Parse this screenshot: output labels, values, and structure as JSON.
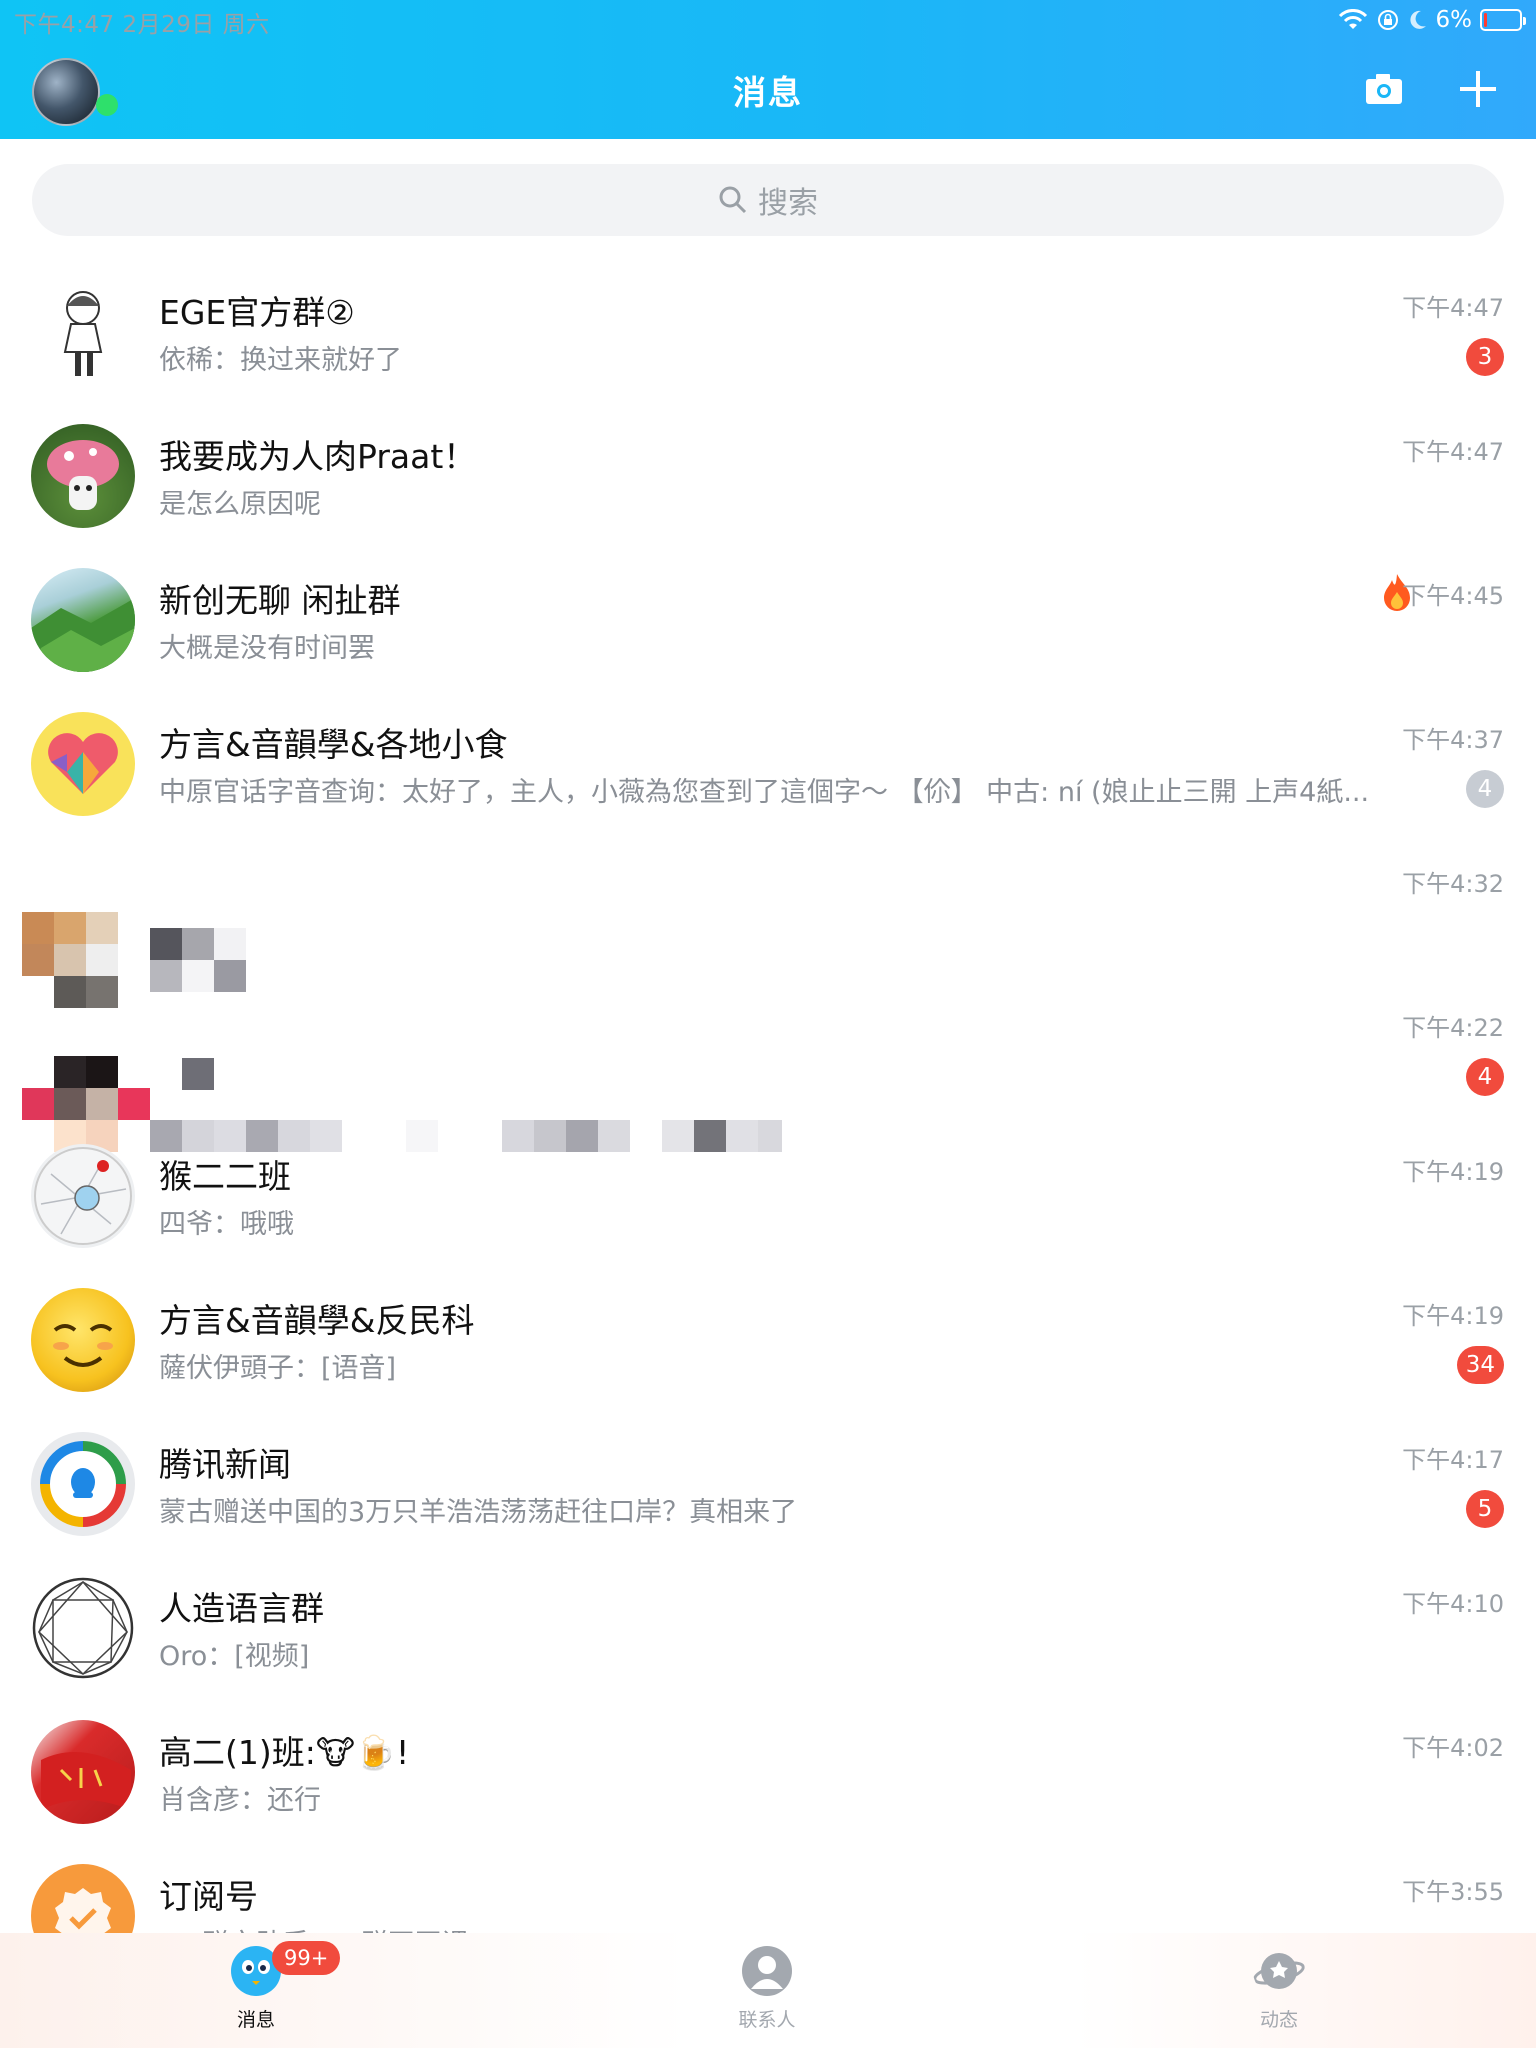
{
  "status_bar": {
    "time_date": "下午4:47   2月29日 周六",
    "battery": "6%",
    "battery_level": 0.06
  },
  "header": {
    "title": "消息",
    "icons": [
      "camera-icon",
      "plus-icon"
    ]
  },
  "search": {
    "placeholder": "搜索"
  },
  "colors": {
    "accent": "#1ab7f7",
    "badge": "#f14b3d",
    "muted_badge": "#c7ccd3",
    "online": "#2ee06b"
  },
  "conversations": [
    {
      "title": "EGE官方群②",
      "preview": "依稀：换过来就好了",
      "time": "下午4:47",
      "badge": "3"
    },
    {
      "title": "我要成为人肉Praat！",
      "preview": "是怎么原因呢",
      "time": "下午4:47",
      "badge": ""
    },
    {
      "title": "新创无聊 闲扯群",
      "preview": "大概是没有时间罢",
      "time": "下午4:45",
      "badge": "",
      "icon": "fire-icon"
    },
    {
      "title": "方言&音韻學&各地小食",
      "preview": "中原官话字音查询：太好了，主人，小薇為您查到了這個字～ 【伱】 中古: ní (娘止止三開 上声4紙...",
      "time": "下午4:37",
      "badge": "4",
      "badge_muted": true
    },
    {
      "title": "",
      "preview": "",
      "time": "下午4:32",
      "badge": ""
    },
    {
      "title": "",
      "preview": "",
      "time": "下午4:22",
      "badge": "4"
    },
    {
      "title": "猴二二班",
      "preview": "四爷：哦哦",
      "time": "下午4:19",
      "badge": ""
    },
    {
      "title": "方言&音韻學&反民科",
      "preview": "薩伏伊頭子：[语音]",
      "time": "下午4:19",
      "badge": "34"
    },
    {
      "title": "腾讯新闻",
      "preview": "蒙古赠送中国的3万只羊浩浩荡荡赶往口岸？真相来了",
      "time": "下午4:17",
      "badge": "5"
    },
    {
      "title": "人造语言群",
      "preview": "Oro：[视频]",
      "time": "下午4:10",
      "badge": ""
    },
    {
      "title": "高二(1)班:🐮🍺!",
      "preview": "肖含彦：还行",
      "time": "下午4:02",
      "badge": ""
    },
    {
      "title": "订阅号",
      "preview": "QQ群文助手 QQ群开网课...",
      "time": "下午3:55",
      "badge": ""
    }
  ],
  "tabbar": {
    "tabs": [
      {
        "label": "消息",
        "icon": "messages-icon",
        "badge": "99+"
      },
      {
        "label": "联系人",
        "icon": "contacts-icon"
      },
      {
        "label": "动态",
        "icon": "planet-icon"
      }
    ]
  }
}
